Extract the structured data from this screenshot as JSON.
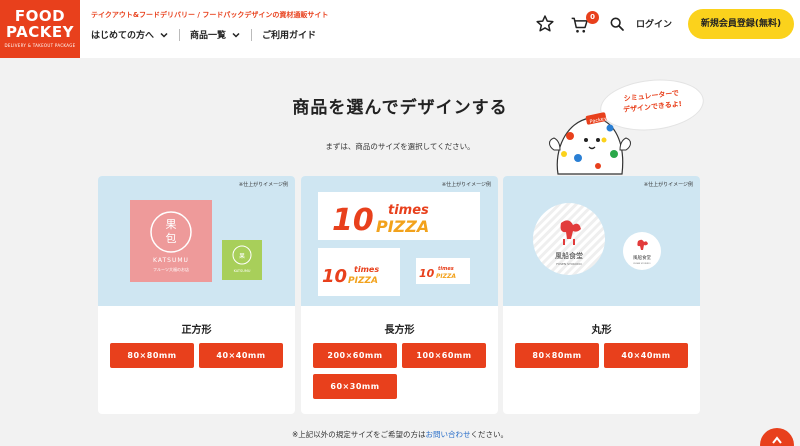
{
  "brand": {
    "logo_line1": "FOOD",
    "logo_line2": "PACKEY",
    "logo_line3": "DELIVERY & TAKEOUT PACKAGE",
    "tagline": "テイクアウト&フードデリバリー / フードパックデザインの資材通販サイト",
    "accent": "#e8401c",
    "yellow": "#fbd21c"
  },
  "nav": {
    "items": [
      {
        "label": "はじめての方へ",
        "has_dropdown": true
      },
      {
        "label": "商品一覧",
        "has_dropdown": true
      },
      {
        "label": "ご利用ガイド",
        "has_dropdown": false
      }
    ]
  },
  "header": {
    "favorites_icon": "star-icon",
    "cart_icon": "cart-icon",
    "cart_count": "0",
    "search_icon": "search-icon",
    "login_label": "ログイン",
    "register_label": "新規会員登録(無料)"
  },
  "main": {
    "title": "商品を選んでデザインする",
    "subtitle": "まずは、商品のサイズを選択してください。",
    "bubble_line1": "シミュレーターで",
    "bubble_line2": "デザインできるよ!",
    "mascot_badge": "Packey",
    "cards": [
      {
        "note": "※仕上がりイメージ例",
        "name": "正方形",
        "sample_big_text1": "果",
        "sample_big_text2": "包",
        "sample_brand": "KATSUMU",
        "sample_sub": "フルーツ大福のお店",
        "buttons": [
          "80×80mm",
          "40×40mm"
        ]
      },
      {
        "note": "※仕上がりイメージ例",
        "name": "長方形",
        "sample_logo_num": "10",
        "sample_logo_word1": "times",
        "sample_logo_word2": "PIZZA",
        "buttons": [
          "200×60mm",
          "100×60mm",
          "60×30mm"
        ]
      },
      {
        "note": "※仕上がりイメージ例",
        "name": "丸形",
        "sample_shop": "風船食堂",
        "sample_shop_sub": "FUSEN SYOKUDO",
        "buttons": [
          "80×80mm",
          "40×40mm"
        ]
      }
    ],
    "footnote_pre": "※上記以外の規定サイズをご希望の方は",
    "footnote_link": "お問い合わせ",
    "footnote_post": "ください。"
  }
}
